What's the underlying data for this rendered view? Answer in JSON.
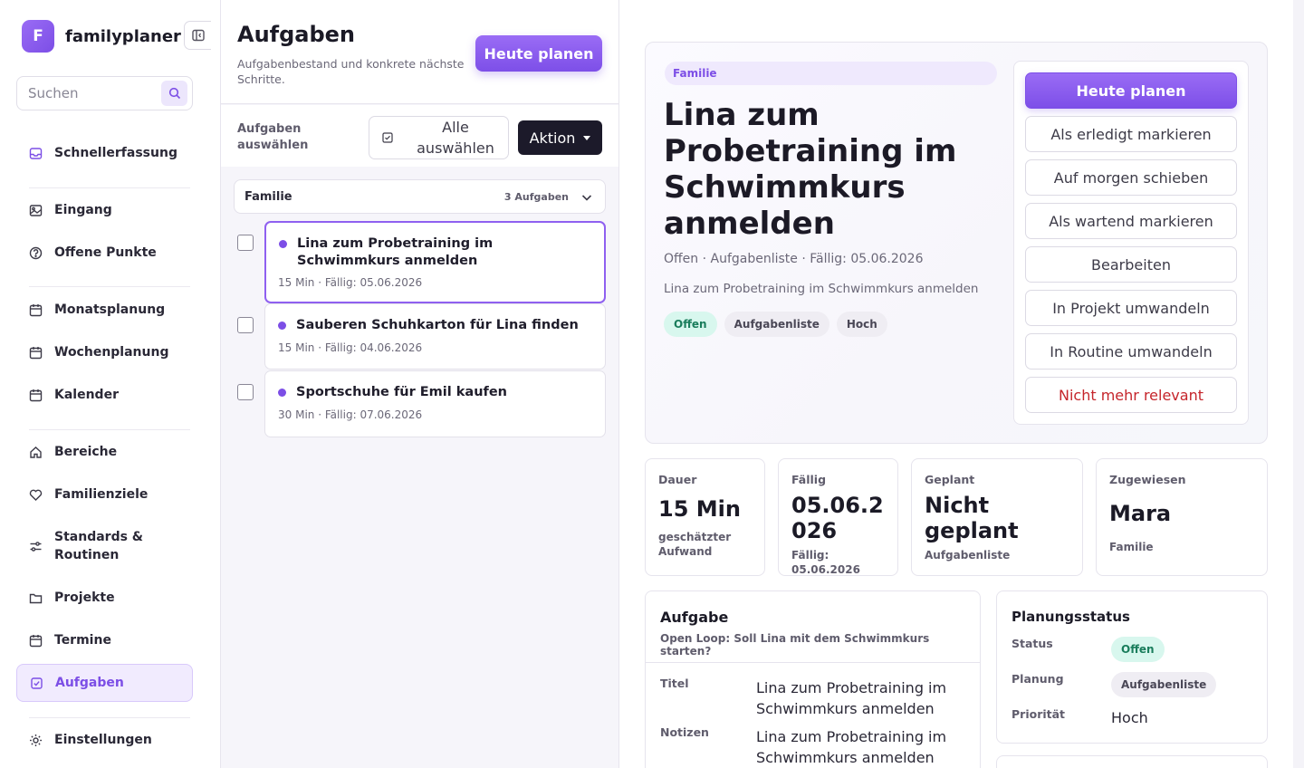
{
  "app": {
    "logo_letter": "F",
    "name": "familyplaner"
  },
  "search": {
    "placeholder": "Suchen"
  },
  "sidebar": {
    "items": [
      {
        "label": "Schnellerfassung",
        "icon": "inbox-icon"
      },
      {
        "label": "Eingang",
        "icon": "image-icon"
      },
      {
        "label": "Offene Punkte",
        "icon": "help-circle-icon"
      },
      {
        "label": "Monatsplanung",
        "icon": "calendar-icon"
      },
      {
        "label": "Wochenplanung",
        "icon": "calendar-icon"
      },
      {
        "label": "Kalender",
        "icon": "calendar-icon"
      },
      {
        "label": "Bereiche",
        "icon": "home-icon"
      },
      {
        "label": "Familienziele",
        "icon": "heart-icon"
      },
      {
        "label": "Standards & Routinen",
        "icon": "sliders-icon"
      },
      {
        "label": "Projekte",
        "icon": "folder-icon"
      },
      {
        "label": "Termine",
        "icon": "calendar-icon"
      },
      {
        "label": "Aufgaben",
        "icon": "checkbox-icon",
        "active": true
      },
      {
        "label": "Einstellungen",
        "icon": "sun-gear-icon"
      }
    ]
  },
  "list": {
    "title": "Aufgaben",
    "subtitle": "Aufgabenbestand und konkrete nächste Schritte.",
    "plan_button": "Heute planen",
    "select_label": "Aufgaben auswählen",
    "select_all": "Alle auswählen",
    "action": "Aktion",
    "group": {
      "name": "Familie",
      "count": "3 Aufgaben"
    },
    "tasks": [
      {
        "title": "Lina zum Probetraining im Schwimmkurs anmelden",
        "meta": "15 Min · Fällig: 05.06.2026"
      },
      {
        "title": "Sauberen Schuhkarton für Lina finden",
        "meta": "15 Min · Fällig: 04.06.2026"
      },
      {
        "title": "Sportschuhe für Emil kaufen",
        "meta": "30 Min · Fällig: 07.06.2026"
      }
    ]
  },
  "detail": {
    "tag": "Familie",
    "title": "Lina zum Probetraining im Schwimmkurs anmelden",
    "meta": "Offen · Aufgabenliste · Fällig: 05.06.2026",
    "notes": "Lina zum Probetraining im Schwimmkurs anmelden",
    "chips": [
      "Offen",
      "Aufgabenliste",
      "Hoch"
    ],
    "actions": [
      "Heute planen",
      "Als erledigt markieren",
      "Auf morgen schieben",
      "Als wartend markieren",
      "Bearbeiten",
      "In Projekt umwandeln",
      "In Routine umwandeln",
      "Nicht mehr relevant"
    ],
    "stats": [
      {
        "label": "Dauer",
        "value": "15 Min",
        "sub": "geschätzter Aufwand"
      },
      {
        "label": "Fällig",
        "value": "05.06.2026",
        "sub": "Fällig: 05.06.2026"
      },
      {
        "label": "Geplant",
        "value": "Nicht geplant",
        "sub": "Aufgabenliste"
      },
      {
        "label": "Zugewiesen",
        "value": "Mara",
        "sub": "Familie"
      }
    ],
    "task_card": {
      "title": "Aufgabe",
      "subtitle": "Open Loop: Soll Lina mit dem Schwimmkurs starten?",
      "fields": [
        {
          "label": "Titel",
          "value": "Lina zum Probetraining im Schwimmkurs anmelden"
        },
        {
          "label": "Notizen",
          "value": "Lina zum Probetraining im Schwimmkurs anmelden"
        }
      ]
    },
    "plan_card": {
      "title": "Planungsstatus",
      "rows": [
        {
          "label": "Status",
          "value": "Offen"
        },
        {
          "label": "Planung",
          "value": "Aufgabenliste"
        },
        {
          "label": "Priorität",
          "value": "Hoch"
        }
      ]
    }
  },
  "colors": {
    "accent": "#7c4ee6",
    "danger": "#c5252b",
    "success_bg": "#d8f7ee"
  }
}
